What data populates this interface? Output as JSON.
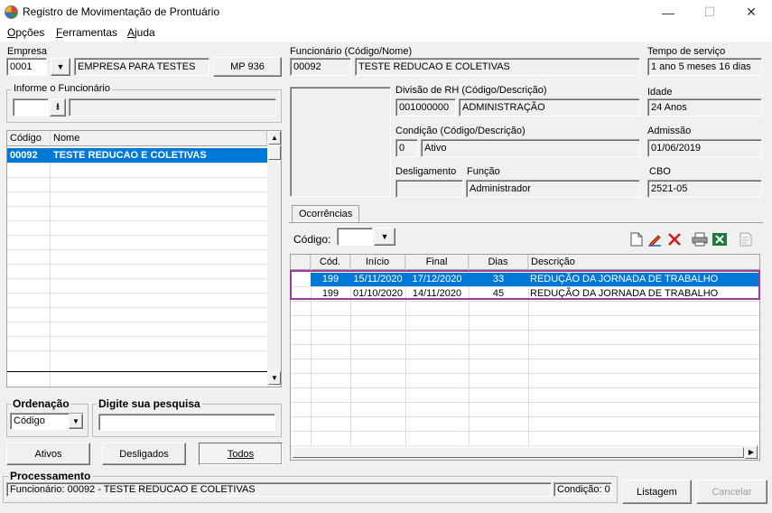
{
  "window": {
    "title": "Registro de Movimentação de Prontuário",
    "minimize": "—",
    "maximize": "☐",
    "close": "✕"
  },
  "menu": {
    "items": [
      {
        "label": "Opções",
        "accel": "O"
      },
      {
        "label": "Ferramentas",
        "accel": "F"
      },
      {
        "label": "Ajuda",
        "accel": "A"
      }
    ]
  },
  "empresa": {
    "label": "Empresa",
    "code": "0001",
    "name": "EMPRESA PARA TESTES",
    "mp_button": "MP 936"
  },
  "informe": {
    "label": "Informe o Funcionário",
    "value": "",
    "extra": ""
  },
  "employee_list": {
    "columns": [
      "Código",
      "Nome"
    ],
    "rows": [
      {
        "codigo": "00092",
        "nome": "TESTE REDUCAO E COLETIVAS"
      }
    ]
  },
  "ordenacao": {
    "label": "Ordenação",
    "selected": "Código"
  },
  "pesquisa": {
    "label": "Digite sua pesquisa",
    "value": ""
  },
  "filters": {
    "ativos": "Ativos",
    "desligados": "Desligados",
    "todos": "Todos"
  },
  "funcionario": {
    "label": "Funcionário (Código/Nome)",
    "code": "00092",
    "name": "TESTE REDUCAO E COLETIVAS"
  },
  "tempo_servico": {
    "label": "Tempo de serviço",
    "value": "1 ano 5 meses 16 dias"
  },
  "divisao": {
    "label": "Divisão de RH (Código/Descrição)",
    "code": "001000000",
    "desc": "ADMINISTRAÇÃO"
  },
  "idade": {
    "label": "Idade",
    "value": "24 Anos"
  },
  "condicao": {
    "label": "Condição (Código/Descrição)",
    "code": "0",
    "desc": "Ativo"
  },
  "admissao": {
    "label": "Admissão",
    "value": "01/06/2019"
  },
  "desligamento": {
    "label": "Desligamento",
    "value": ""
  },
  "funcao": {
    "label": "Função",
    "value": "Administrador"
  },
  "cbo": {
    "label": "CBO",
    "value": "2521-05"
  },
  "ocorrencias": {
    "tab": "Ocorrências",
    "codigo_label": "Código:",
    "codigo_value": "",
    "columns": [
      "Cód.",
      "Início",
      "Final",
      "Dias",
      "Descrição"
    ],
    "rows": [
      {
        "cod": "199",
        "inicio": "15/11/2020",
        "final": "17/12/2020",
        "dias": "33",
        "descricao": "REDUÇÃO DA JORNADA DE TRABALHO",
        "selected": true
      },
      {
        "cod": "199",
        "inicio": "01/10/2020",
        "final": "14/11/2020",
        "dias": "45",
        "descricao": "REDUÇÃO DA JORNADA DE TRABALHO",
        "selected": false
      }
    ],
    "highlight_color": "#9b3d9b"
  },
  "toolbar_icons": [
    "new-document-icon",
    "edit-pencil-icon",
    "delete-x-icon",
    "print-icon",
    "excel-export-icon",
    "report-preview-icon"
  ],
  "processamento": {
    "label": "Processamento",
    "status": "Funcionário: 00092 - TESTE REDUCAO E COLETIVAS",
    "condicao": "Condição: 0"
  },
  "actions": {
    "listagem": "Listagem",
    "cancelar": "Cancelar"
  },
  "colors": {
    "selection": "#0078d7",
    "window_bg": "#f0f0f0"
  }
}
